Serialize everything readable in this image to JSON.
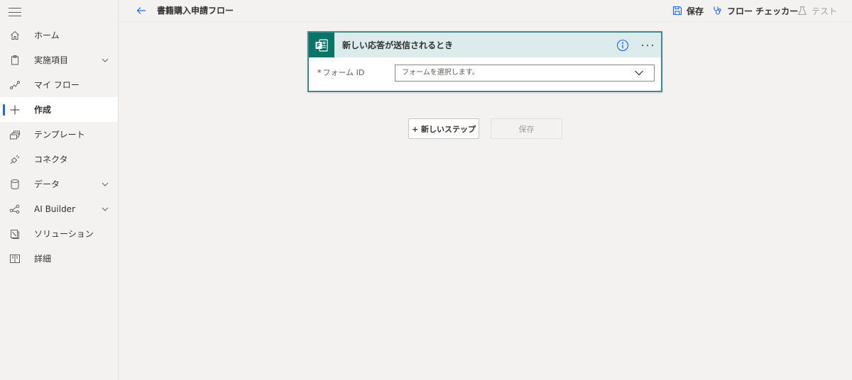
{
  "header": {
    "flow_title": "書籍購入申請フロー",
    "actions": {
      "save": "保存",
      "flow_checker": "フロー チェッカー",
      "test": "テスト"
    }
  },
  "sidebar": {
    "items": [
      {
        "label": "ホーム",
        "icon": "home-icon"
      },
      {
        "label": "実施項目",
        "icon": "clipboard-icon",
        "expandable": true
      },
      {
        "label": "マイ フロー",
        "icon": "flow-icon"
      },
      {
        "label": "作成",
        "icon": "plus-icon",
        "active": true
      },
      {
        "label": "テンプレート",
        "icon": "templates-icon"
      },
      {
        "label": "コネクタ",
        "icon": "connector-icon"
      },
      {
        "label": "データ",
        "icon": "database-icon",
        "expandable": true
      },
      {
        "label": "AI Builder",
        "icon": "ai-builder-icon",
        "expandable": true
      },
      {
        "label": "ソリューション",
        "icon": "solutions-icon"
      },
      {
        "label": "詳細",
        "icon": "book-icon"
      }
    ]
  },
  "trigger": {
    "title": "新しい応答が送信されるとき",
    "field_required_mark": "*",
    "field_label": "フォーム ID",
    "field_placeholder": "フォームを選択します。"
  },
  "canvas": {
    "new_step_label": "+ 新しいステップ",
    "save_label": "保存"
  },
  "colors": {
    "accent": "#2266e3",
    "forms_brand": "#077568",
    "card_border": "#46868a",
    "card_header": "#dcebeb"
  }
}
